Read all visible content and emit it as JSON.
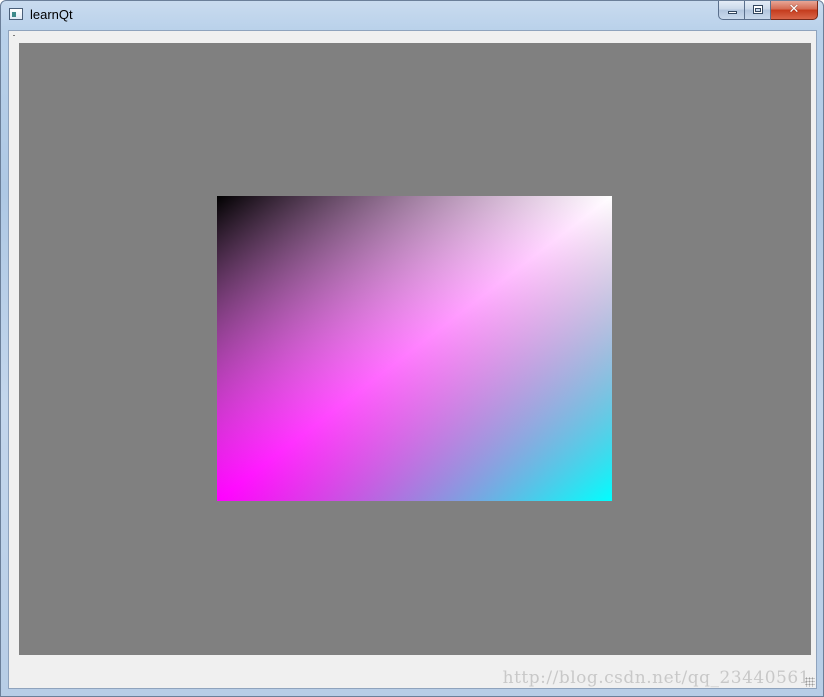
{
  "window": {
    "title": "learnQt",
    "icon": "qt-window-app-icon",
    "caption_buttons": {
      "minimize_icon": "minimize-icon",
      "maximize_icon": "maximize-icon",
      "close_icon": "close-icon",
      "close_glyph": "✕"
    }
  },
  "canvas": {
    "background_color": "#808080",
    "gradient": {
      "type": "linear",
      "direction": "bottom-left to top-right",
      "stops": [
        {
          "offset": 0.0,
          "color": "#ff00ff"
        },
        {
          "offset": 0.5,
          "color": "#ff80ff"
        },
        {
          "offset": 1.0,
          "color": "#ffffff"
        }
      ],
      "overlay_stops": [
        {
          "offset": 0.0,
          "color": "#000000"
        },
        {
          "offset": 1.0,
          "color": "#00ffff"
        }
      ]
    }
  },
  "watermark": {
    "text": "http://blog.csdn.net/qq_23440561"
  }
}
